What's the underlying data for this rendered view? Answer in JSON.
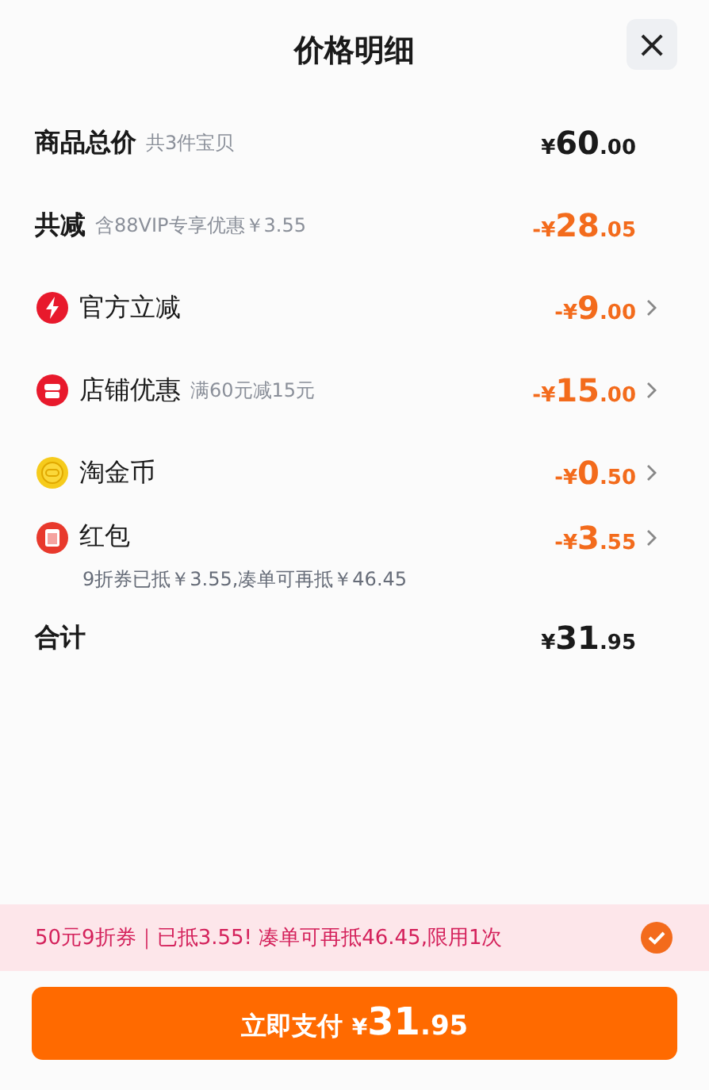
{
  "title": "价格明细",
  "close": "×",
  "rows": [
    {
      "kind": "summary",
      "label": "商品总价",
      "note": "共3件宝贝",
      "amount": {
        "sign": "¥",
        "whole": "60",
        "fraction": ".00"
      },
      "discount": false
    },
    {
      "kind": "summary",
      "label": "共减",
      "note": "含88VIP专享优惠￥3.55",
      "amount": {
        "sign": "-¥",
        "whole": "28",
        "fraction": ".05"
      },
      "discount": true
    },
    {
      "kind": "official",
      "label": "官方立减",
      "amount": {
        "sign": "-¥",
        "whole": "9",
        "fraction": ".00"
      },
      "discount": true
    },
    {
      "kind": "store",
      "label": "店铺优惠",
      "note": "满60元减15元",
      "amount": {
        "sign": "-¥",
        "whole": "15",
        "fraction": ".00"
      },
      "discount": true
    },
    {
      "kind": "coin",
      "label": "淘金币",
      "amount": {
        "sign": "-¥",
        "whole": "0",
        "fraction": ".50"
      },
      "discount": true
    },
    {
      "kind": "packet",
      "label": "红包",
      "amount": {
        "sign": "-¥",
        "whole": "3",
        "fraction": ".55"
      },
      "discount": true,
      "sub": "9折券已抵￥3.55,凑单可再抵￥46.45"
    },
    {
      "kind": "summary",
      "label": "合计",
      "amount": {
        "sign": "¥",
        "whole": "31",
        "fraction": ".95"
      },
      "discount": false
    }
  ],
  "coupon": {
    "text": "50元9折券｜已抵3.55! 凑单可再抵46.45,限用1次",
    "checked": true
  },
  "pay": {
    "label": "立即支付",
    "sign": "¥",
    "whole": "31",
    "fraction": ".95"
  }
}
